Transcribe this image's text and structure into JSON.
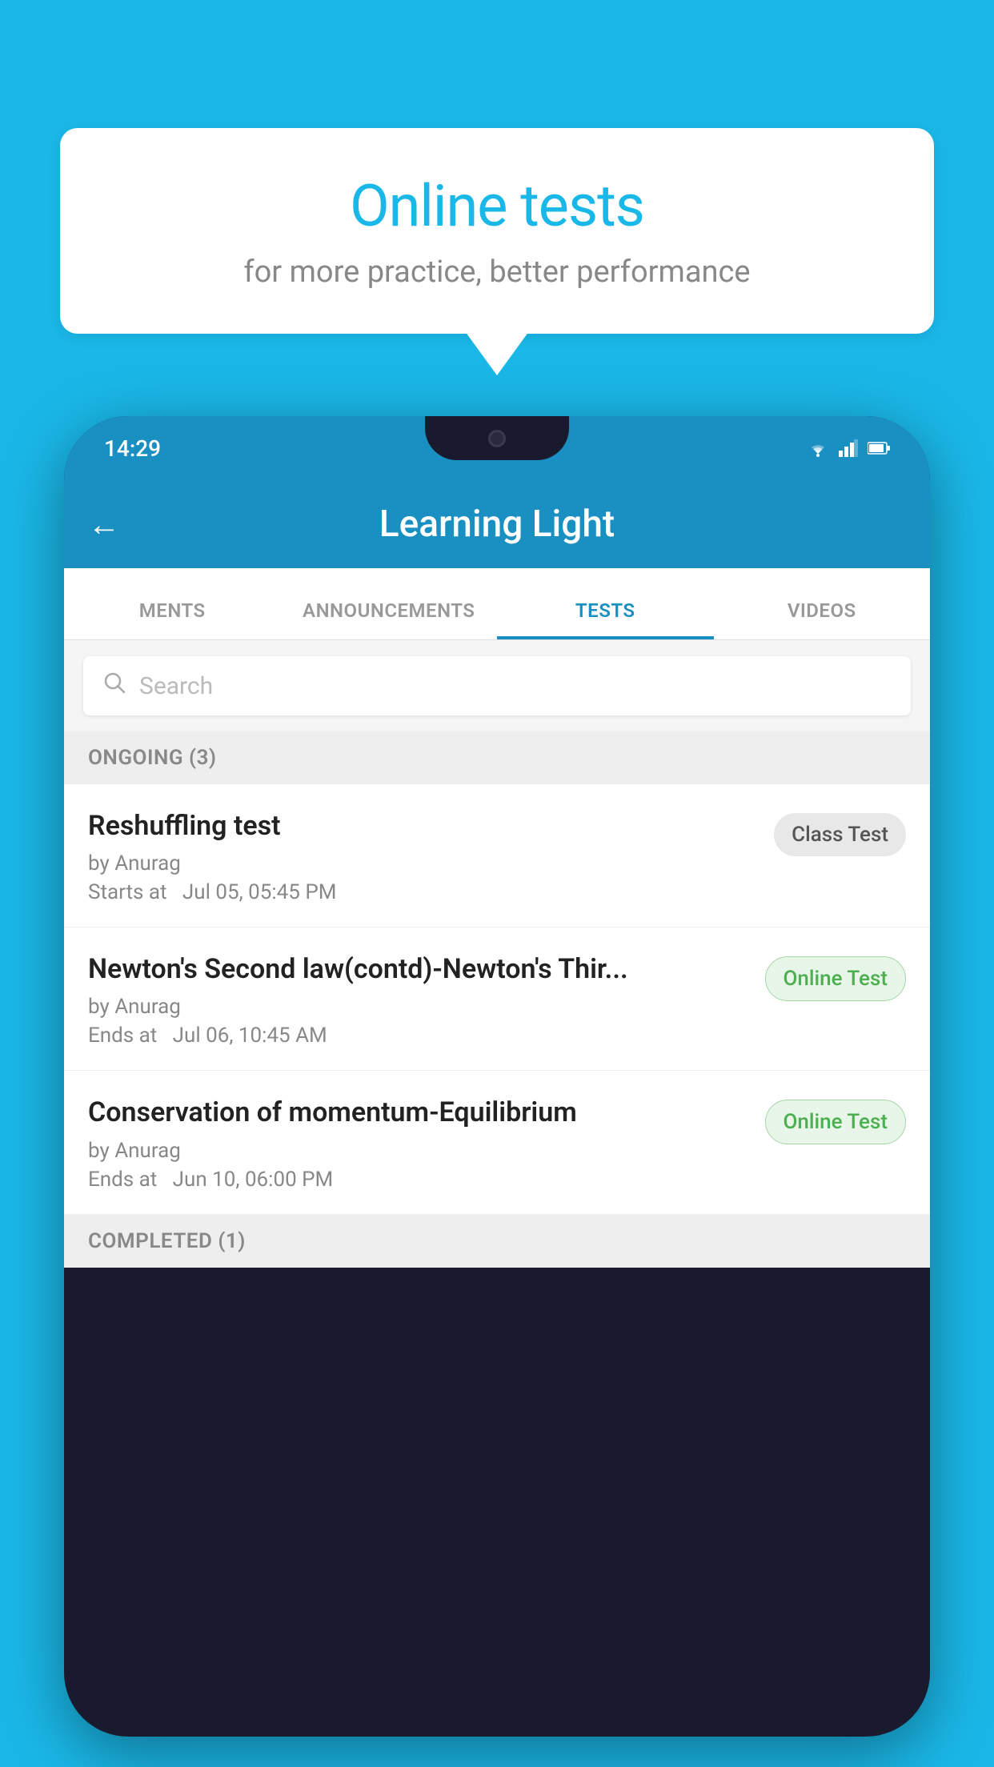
{
  "background": {
    "color": "#1ab8e8"
  },
  "speech_bubble": {
    "title": "Online tests",
    "subtitle": "for more practice, better performance"
  },
  "phone": {
    "status_bar": {
      "time": "14:29",
      "icons": [
        "wifi",
        "signal",
        "battery"
      ]
    },
    "app_bar": {
      "back_label": "←",
      "title": "Learning Light"
    },
    "tabs": [
      {
        "label": "MENTS",
        "active": false
      },
      {
        "label": "ANNOUNCEMENTS",
        "active": false
      },
      {
        "label": "TESTS",
        "active": true
      },
      {
        "label": "VIDEOS",
        "active": false
      }
    ],
    "search": {
      "placeholder": "Search"
    },
    "ongoing_section": {
      "label": "ONGOING (3)"
    },
    "tests": [
      {
        "name": "Reshuffling test",
        "author": "by Anurag",
        "time_label": "Starts at",
        "time": "Jul 05, 05:45 PM",
        "badge": "Class Test",
        "badge_type": "class"
      },
      {
        "name": "Newton's Second law(contd)-Newton's Thir...",
        "author": "by Anurag",
        "time_label": "Ends at",
        "time": "Jul 06, 10:45 AM",
        "badge": "Online Test",
        "badge_type": "online"
      },
      {
        "name": "Conservation of momentum-Equilibrium",
        "author": "by Anurag",
        "time_label": "Ends at",
        "time": "Jun 10, 06:00 PM",
        "badge": "Online Test",
        "badge_type": "online"
      }
    ],
    "completed_section": {
      "label": "COMPLETED (1)"
    }
  }
}
